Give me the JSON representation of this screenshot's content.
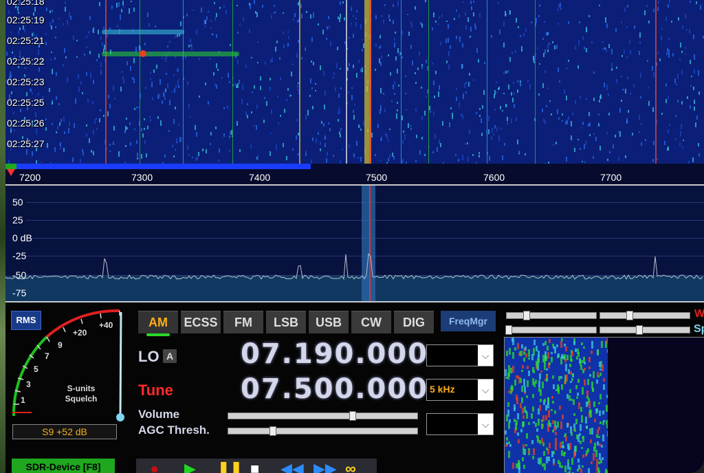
{
  "waterfall": {
    "timestamps": [
      "02:25:18",
      "02:25:19",
      "02:25:21",
      "02:25:22",
      "02:25:23",
      "02:25:25",
      "02:25:26",
      "02:25:27"
    ]
  },
  "axis": {
    "labels": [
      "7200",
      "7300",
      "7400",
      "7500",
      "7600",
      "7700"
    ]
  },
  "spectrum": {
    "db_labels": [
      "50",
      "25",
      "0 dB",
      "-25",
      "-50",
      "-75"
    ]
  },
  "smeter": {
    "rms_label": "RMS",
    "scale": [
      "1",
      "3",
      "5",
      "7",
      "9",
      "+20",
      "+40"
    ],
    "caption_line1": "S-units",
    "caption_line2": "Squelch",
    "reading": "S9 +52 dB",
    "sdr_device_label": "SDR-Device [F8]"
  },
  "modes": {
    "items": [
      "AM",
      "ECSS",
      "FM",
      "LSB",
      "USB",
      "CW",
      "DIG"
    ],
    "active": "AM",
    "freqmgr_label": "FreqMgr"
  },
  "tuning": {
    "lo_label": "LO",
    "lo_badge": "A",
    "lo_freq": "07.190.000",
    "tune_label": "Tune",
    "tune_freq": "07.500.000",
    "step_value": "5 kHz",
    "volume_label": "Volume",
    "agc_label": "AGC Thresh.",
    "combo_arrow": "⌵"
  },
  "right_panel": {
    "label1": "W",
    "label2": "Sp"
  },
  "colors": {
    "accent_mode": "#ffae1a",
    "tune_red": "#ff2a2a",
    "freq_text": "#d4d6ea",
    "waterfall_bg": "#0b1f78",
    "spectrum_bg": "#08123f"
  }
}
